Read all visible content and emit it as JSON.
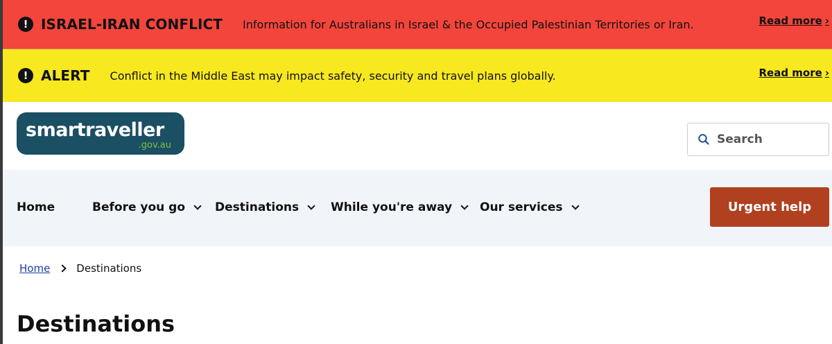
{
  "banners": {
    "conflict": {
      "icon": "exclamation-icon",
      "title": "ISRAEL-IRAN CONFLICT",
      "text": "Information for Australians in Israel & the Occupied Palestinian Territories or Iran.",
      "link": "Read more",
      "color": "#f3453c"
    },
    "alert": {
      "icon": "exclamation-icon",
      "title": "ALERT",
      "text": "Conflict in the Middle East may impact safety, security and travel plans globally.",
      "link": "Read more",
      "color": "#f7e81f"
    }
  },
  "header": {
    "logo": {
      "word": "smartraveller",
      "domain": ".gov.au",
      "bg_color": "#1b4f63",
      "domain_color": "#7cc242"
    },
    "search": {
      "icon": "search-icon",
      "placeholder": "Search"
    }
  },
  "nav": {
    "items": [
      {
        "label": "Home",
        "has_dropdown": false
      },
      {
        "label": "Before you go",
        "has_dropdown": true
      },
      {
        "label": "Destinations",
        "has_dropdown": true
      },
      {
        "label": "While you're away",
        "has_dropdown": true
      },
      {
        "label": "Our services",
        "has_dropdown": true
      }
    ],
    "urgent_help": "Urgent help",
    "urgent_color": "#b0401f",
    "bg_color": "#f1f4f9"
  },
  "breadcrumb": {
    "home": "Home",
    "current": "Destinations"
  },
  "page": {
    "title": "Destinations"
  }
}
